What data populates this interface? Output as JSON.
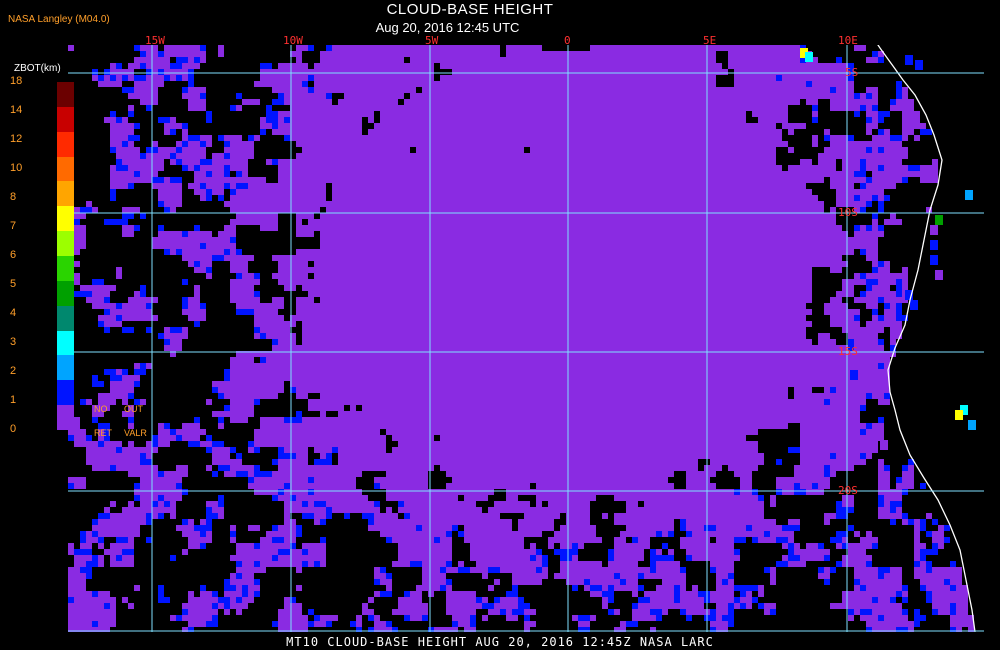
{
  "header": {
    "producer": "NASA Langley (M04.0)",
    "title": "CLOUD-BASE HEIGHT",
    "subtitle": "Aug 20, 2016 12:45 UTC"
  },
  "footer": {
    "caption": "MT10  CLOUD-BASE HEIGHT   AUG 20, 2016 12:45Z   NASA LARC"
  },
  "legend": {
    "unit_label": "ZBOT(km)",
    "ticks": [
      "18",
      "14",
      "12",
      "10",
      "8",
      "7",
      "6",
      "5",
      "4",
      "3",
      "2",
      "1",
      "0"
    ],
    "colors": [
      "#6b0000",
      "#c80000",
      "#ff2a00",
      "#ff6a00",
      "#ffa500",
      "#ffff00",
      "#9cff00",
      "#2ad400",
      "#00a000",
      "#00886e",
      "#00ffff",
      "#00a4ff",
      "#0014ff",
      "#8a2be2"
    ],
    "no_ret_label_1": "NO",
    "no_ret_label_2": "RET",
    "out_label_1": "OUT",
    "out_label_2": "VALR"
  },
  "map": {
    "lon_labels": [
      "15W",
      "10W",
      "5W",
      "0",
      "5E",
      "10E"
    ],
    "lat_labels": [
      "5S",
      "10S",
      "15S",
      "20S"
    ],
    "background_color": "#000000",
    "cloud_color": "#8a2be2",
    "grid_color": "#7fe0ff",
    "coast_color": "#ffffff"
  }
}
